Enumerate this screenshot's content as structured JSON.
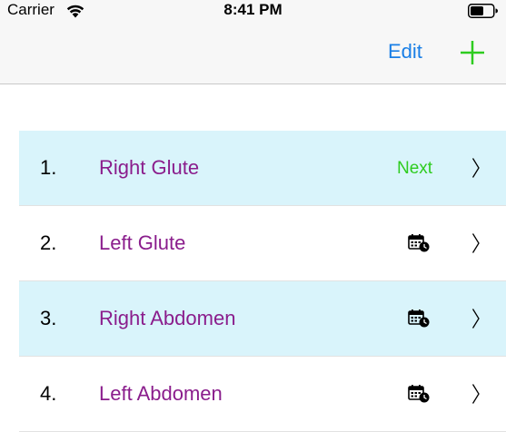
{
  "status_bar": {
    "carrier": "Carrier",
    "time": "8:41 PM",
    "wifi_icon": "wifi-icon",
    "battery_icon": "battery-icon"
  },
  "nav_bar": {
    "edit_label": "Edit",
    "add_icon": "plus-icon",
    "accent_color": "#1a7fe6",
    "add_color": "#2ecc1f"
  },
  "rows": [
    {
      "number": "1.",
      "label": "Right Glute",
      "status": "Next",
      "status_icon": "",
      "highlighted": true
    },
    {
      "number": "2.",
      "label": "Left Glute",
      "status": "",
      "status_icon": "calendar-clock-icon",
      "highlighted": false
    },
    {
      "number": "3.",
      "label": "Right Abdomen",
      "status": "",
      "status_icon": "calendar-clock-icon",
      "highlighted": true
    },
    {
      "number": "4.",
      "label": "Left Abdomen",
      "status": "",
      "status_icon": "calendar-clock-icon",
      "highlighted": false
    }
  ],
  "colors": {
    "highlight_row": "#d9f4fb",
    "label_text": "#8a1d8c",
    "next_text": "#2ecc1f"
  }
}
